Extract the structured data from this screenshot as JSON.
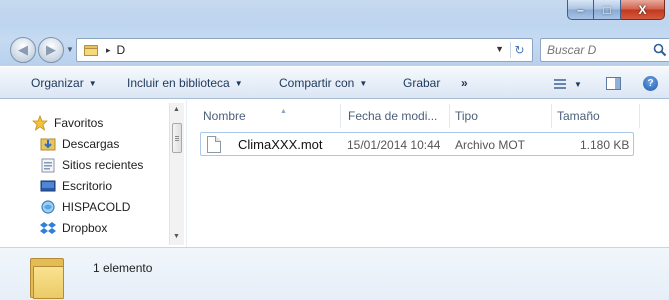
{
  "window": {
    "minimize_glyph": "–",
    "maximize_glyph": "□",
    "close_glyph": "X"
  },
  "address": {
    "crumbs": [
      "D"
    ],
    "separator": "▸"
  },
  "search": {
    "placeholder": "Buscar D"
  },
  "toolbar": {
    "organize": "Organizar",
    "library": "Incluir en biblioteca",
    "share": "Compartir con",
    "burn": "Grabar",
    "more": "»",
    "help": "?"
  },
  "navigation": {
    "favorites": "Favoritos",
    "items": [
      {
        "label": "Descargas",
        "icon": "downloads-icon"
      },
      {
        "label": "Sitios recientes",
        "icon": "recent-places-icon"
      },
      {
        "label": "Escritorio",
        "icon": "desktop-icon"
      },
      {
        "label": "HISPACOLD",
        "icon": "network-folder-icon"
      },
      {
        "label": "Dropbox",
        "icon": "dropbox-icon"
      }
    ]
  },
  "file_list": {
    "columns": [
      "Nombre",
      "Fecha de modi...",
      "Tipo",
      "Tamaño"
    ],
    "rows": [
      {
        "name": "ClimaXXX.mot",
        "date": "15/01/2014 10:44",
        "type": "Archivo MOT",
        "size": "1.180 KB"
      }
    ]
  },
  "details": {
    "item_count": "1 elemento"
  },
  "colors": {
    "accent": "#1e395b",
    "selection_border": "#a9c8ea",
    "close_button": "#c2381e"
  }
}
